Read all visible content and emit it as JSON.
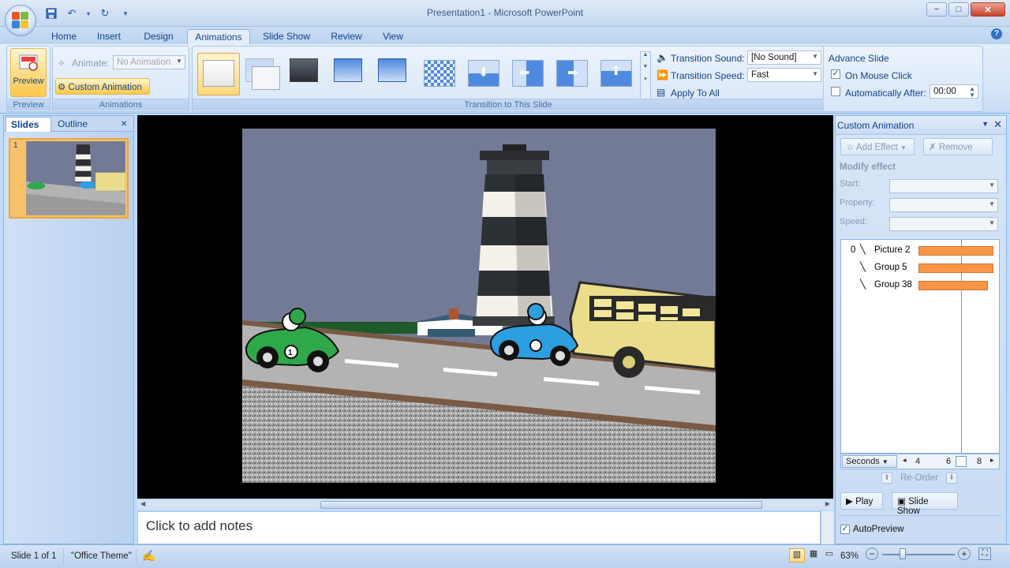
{
  "window": {
    "title": "Presentation1 - Microsoft PowerPoint",
    "min": "−",
    "max": "□",
    "close": "✕"
  },
  "tabs": [
    "Home",
    "Insert",
    "Design",
    "Animations",
    "Slide Show",
    "Review",
    "View"
  ],
  "ribbon": {
    "preview": {
      "button": "Preview",
      "group": "Preview"
    },
    "animations": {
      "animate_label": "Animate:",
      "animate_value": "No Animation",
      "custom_animation": "Custom Animation",
      "group": "Animations"
    },
    "transition": {
      "group": "Transition to This Slide",
      "sound_label": "Transition Sound:",
      "sound_value": "[No Sound]",
      "speed_label": "Transition Speed:",
      "speed_value": "Fast",
      "apply_all": "Apply To All"
    },
    "advance": {
      "title": "Advance Slide",
      "on_click": "On Mouse Click",
      "on_click_checked": true,
      "auto_label": "Automatically After:",
      "auto_value": "00:00"
    }
  },
  "left_pane": {
    "tab_slides": "Slides",
    "tab_outline": "Outline",
    "close": "×",
    "slide_number": "1"
  },
  "notes_placeholder": "Click to add notes",
  "task_pane": {
    "title": "Custom Animation",
    "add_effect": "Add Effect",
    "remove": "Remove",
    "modify_effect": "Modify effect",
    "start_label": "Start:",
    "property_label": "Property:",
    "speed_label": "Speed:",
    "items": [
      {
        "index": "0",
        "name": "Picture 2",
        "bar": 0.95
      },
      {
        "index": "",
        "name": "Group 5",
        "bar": 0.95
      },
      {
        "index": "",
        "name": "Group 38",
        "bar": 0.88
      }
    ],
    "seconds": "Seconds",
    "ticks": [
      "4",
      "6",
      "8"
    ],
    "reorder": "Re-Order",
    "play": "Play",
    "slide_show": "Slide Show",
    "autopreview": "AutoPreview",
    "autopreview_checked": true
  },
  "status": {
    "slide": "Slide 1 of 1",
    "theme": "\"Office Theme\"",
    "zoom": "63%"
  },
  "colors": {
    "sky": "#737a96",
    "road": "#b3b3b3",
    "bar": "#f79646",
    "accent": "#ffd77a"
  }
}
